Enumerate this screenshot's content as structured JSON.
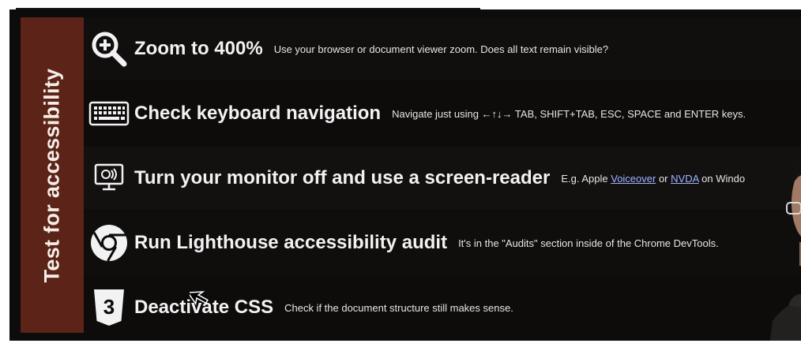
{
  "side_title": "Test for accessibility",
  "rows": [
    {
      "icon": "zoom-in-icon",
      "heading": "Zoom to 400%",
      "desc": "Use your browser or document viewer zoom. Does all text remain visible?"
    },
    {
      "icon": "keyboard-icon",
      "heading": "Check keyboard navigation",
      "desc": "Navigate just using ←↑↓→ TAB, SHIFT+TAB, ESC, SPACE and ENTER keys."
    },
    {
      "icon": "screen-reader-monitor-icon",
      "heading": "Turn your monitor off and use a screen-reader",
      "desc_prefix": "E.g. Apple",
      "link1": "Voiceover",
      "desc_mid": "or",
      "link2": "NVDA",
      "desc_suffix": "on Windo"
    },
    {
      "icon": "chrome-icon",
      "heading": "Run Lighthouse accessibility audit",
      "desc": "It's in the \"Audits\" section inside of the Chrome DevTools."
    },
    {
      "icon": "css3-icon",
      "heading": "Deactivate CSS",
      "desc": "Check if the document structure still makes sense."
    }
  ],
  "colors": {
    "side_band": "#5c2418",
    "background": "#0d0b0b",
    "link": "#9fb4ff"
  }
}
